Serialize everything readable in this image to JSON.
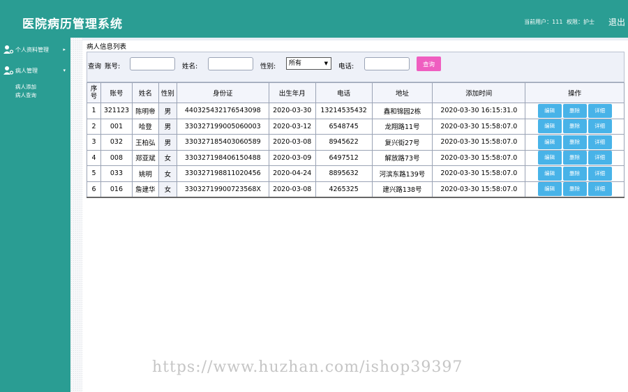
{
  "header": {
    "title": "医院病历管理系统",
    "user_label": "当前用户：",
    "user": "111",
    "role_label": "权限：",
    "role": "护士",
    "logout": "退出"
  },
  "sidebar": {
    "menus": [
      {
        "label": "个人资料管理",
        "icon": "user-icon",
        "arrow": "▸"
      },
      {
        "label": "病人管理",
        "icon": "patient-icon",
        "arrow": "▾",
        "children": [
          "病人添加",
          "病人查询"
        ]
      }
    ]
  },
  "main": {
    "section_title": "病人信息列表",
    "search": {
      "query_label": "查询",
      "account_label": "账号:",
      "name_label": "姓名:",
      "gender_label": "性别:",
      "gender_value": "所有",
      "phone_label": "电话:",
      "account_value": "",
      "name_value": "",
      "phone_value": "",
      "button": "查询"
    },
    "table": {
      "headers": [
        "序号",
        "账号",
        "姓名",
        "性别",
        "身份证",
        "出生年月",
        "电话",
        "地址",
        "添加时间",
        "操作"
      ],
      "rows": [
        [
          "1",
          "321123",
          "陈明帝",
          "男",
          "440325432176543098",
          "2020-03-30",
          "13214535432",
          "鑫和锦园2栋",
          "2020-03-30 16:15:31.0"
        ],
        [
          "2",
          "001",
          "哈登",
          "男",
          "330327199005060003",
          "2020-03-12",
          "6548745",
          "龙翔路11号",
          "2020-03-30 15:58:07.0"
        ],
        [
          "3",
          "032",
          "王柏弘",
          "男",
          "330327185403060589",
          "2020-03-08",
          "8945622",
          "复兴街27号",
          "2020-03-30 15:58:07.0"
        ],
        [
          "4",
          "008",
          "郑亚斌",
          "女",
          "330327198406150488",
          "2020-03-09",
          "6497512",
          "解放路73号",
          "2020-03-30 15:58:07.0"
        ],
        [
          "5",
          "033",
          "姚明",
          "女",
          "330327198811020456",
          "2020-04-24",
          "8895632",
          "河滨东路139号",
          "2020-03-30 15:58:07.0"
        ],
        [
          "6",
          "016",
          "詹建华",
          "女",
          "33032719900723568X",
          "2020-03-08",
          "4265325",
          "建兴路138号",
          "2020-03-30 15:58:07.0"
        ]
      ],
      "actions": [
        "编辑",
        "删除",
        "详细"
      ]
    }
  },
  "watermark": "https://www.huzhan.com/ishop39397",
  "colors": {
    "brand": "#2a9d93",
    "query_button": "#ef5ec0",
    "action_button": "#48b3e8"
  }
}
